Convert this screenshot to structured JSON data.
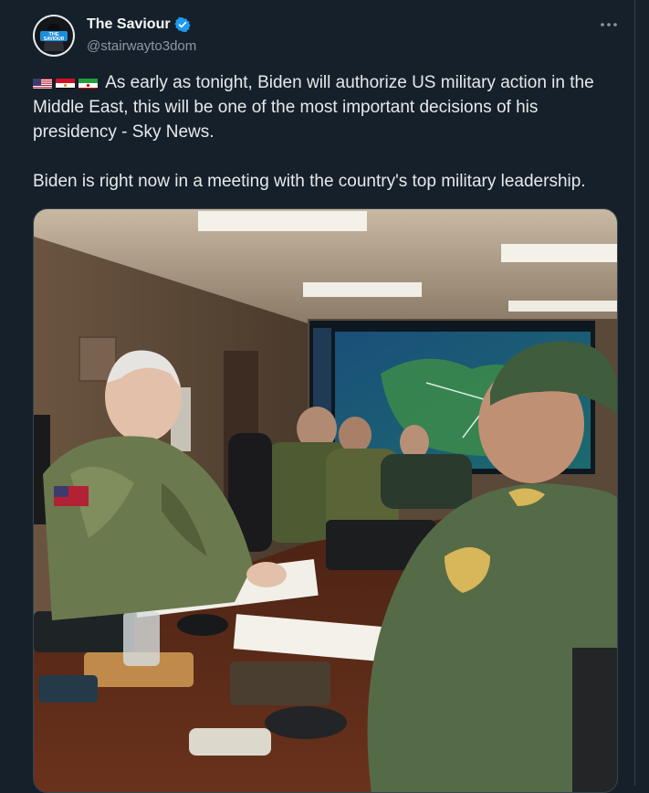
{
  "author": {
    "display_name": "The Saviour",
    "handle": "@stairwayto3dom",
    "avatar_text": "THE SAVIOUR",
    "verified_icon": "verified-badge-icon"
  },
  "menu": {
    "more_icon": "more-horizontal-icon"
  },
  "tweet": {
    "flags": [
      "us-flag",
      "egypt-flag",
      "iran-flag"
    ],
    "paragraph1": "As early as tonight, Biden will authorize US military action in the Middle East, this will be one of the most important decisions of his presidency - Sky News.",
    "paragraph2": "Biden is right now in a meeting with the country's top military leadership."
  },
  "colors": {
    "background": "#15202b",
    "text": "#e7e9ea",
    "secondary": "#8b98a5",
    "verified": "#1d9bf0"
  }
}
